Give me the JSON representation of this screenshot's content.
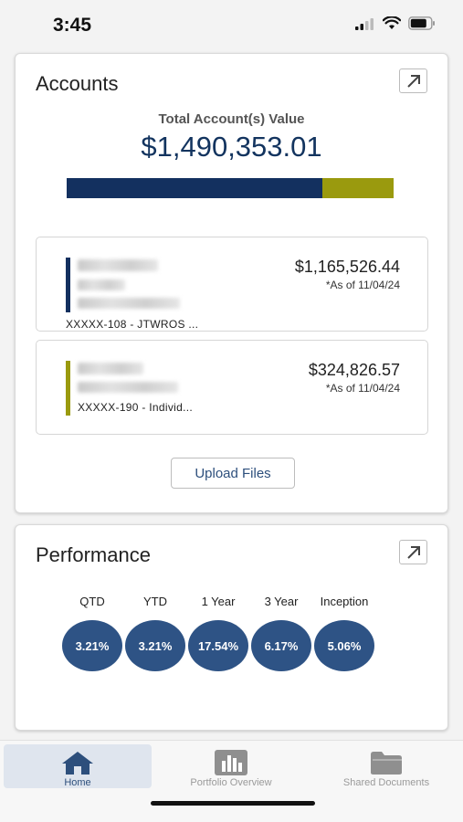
{
  "status_bar": {
    "time": "3:45"
  },
  "accounts": {
    "title": "Accounts",
    "total_label": "Total Account(s) Value",
    "total_value": "$1,490,353.01",
    "allocation": [
      {
        "fraction": 0.782,
        "color": "#13305f"
      },
      {
        "fraction": 0.218,
        "color": "#9a9a0e"
      }
    ],
    "items": [
      {
        "number": "XXXXX-108 - JTWROS ...",
        "value": "$1,165,526.44",
        "as_of": "*As of 11/04/24",
        "color": "#13305f"
      },
      {
        "number": "XXXXX-190 - Individ...",
        "value": "$324,826.57",
        "as_of": "*As of 11/04/24",
        "color": "#9a9a0e"
      }
    ],
    "upload_label": "Upload Files"
  },
  "performance": {
    "title": "Performance",
    "periods": [
      {
        "label": "QTD",
        "value": "3.21%"
      },
      {
        "label": "YTD",
        "value": "3.21%"
      },
      {
        "label": "1 Year",
        "value": "17.54%"
      },
      {
        "label": "3 Year",
        "value": "6.17%"
      },
      {
        "label": "Inception",
        "value": "5.06%"
      }
    ]
  },
  "tabs": {
    "home": "Home",
    "portfolio": "Portfolio Overview",
    "documents": "Shared Documents"
  }
}
